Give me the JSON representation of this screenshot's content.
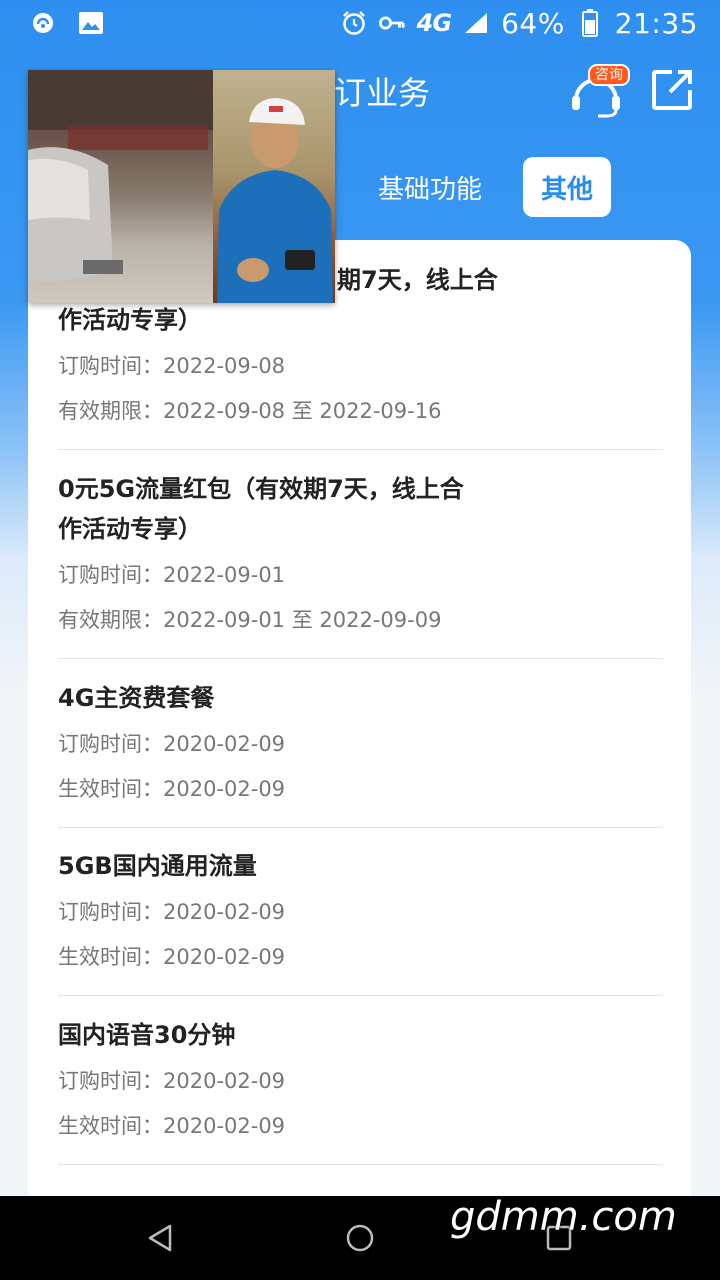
{
  "status_bar": {
    "percent": "64%",
    "time": "21:35",
    "network": "4G"
  },
  "header": {
    "title_partial": "订业务",
    "consult_badge": "咨询"
  },
  "tabs": {
    "basic": "基础功能",
    "other": "其他"
  },
  "items": [
    {
      "title_line1": "期7天，线上合",
      "title_line2": "作活动专享）",
      "line1_label": "订购时间：",
      "line1_value": "2022-09-08",
      "line2_label": "有效期限：",
      "line2_value": "2022-09-08 至 2022-09-16"
    },
    {
      "title_line1": "0元5G流量红包（有效期7天，线上合",
      "title_line2": "作活动专享）",
      "line1_label": "订购时间：",
      "line1_value": "2022-09-01",
      "line2_label": "有效期限：",
      "line2_value": "2022-09-01 至 2022-09-09"
    },
    {
      "title_line1": "4G主资费套餐",
      "line1_label": "订购时间：",
      "line1_value": "2020-02-09",
      "line2_label": "生效时间：",
      "line2_value": "2020-02-09"
    },
    {
      "title_line1": "5GB国内通用流量",
      "line1_label": "订购时间：",
      "line1_value": "2020-02-09",
      "line2_label": "生效时间：",
      "line2_value": "2020-02-09"
    },
    {
      "title_line1": "国内语音30分钟",
      "line1_label": "订购时间：",
      "line1_value": "2020-02-09",
      "line2_label": "生效时间：",
      "line2_value": "2020-02-09"
    }
  ],
  "watermark": "gdmm.com",
  "icons": {
    "status": [
      "notification-icon",
      "image-icon",
      "alarm-icon",
      "key-icon",
      "signal-icon",
      "battery-icon"
    ],
    "header": [
      "headset-icon",
      "share-icon"
    ],
    "nav": [
      "back-icon",
      "home-icon",
      "recents-icon"
    ]
  },
  "colors": {
    "accent": "#2a8bec",
    "badge": "#ff5a1f"
  }
}
